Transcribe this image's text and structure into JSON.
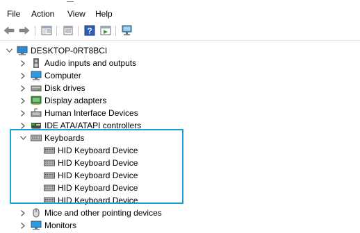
{
  "menu": {
    "file": "File",
    "action": "Action",
    "view": "View",
    "help": "Help"
  },
  "toolbar": {
    "icons": [
      "back-arrow-icon",
      "forward-arrow-icon",
      "show-hide-tree-icon",
      "properties-icon",
      "help-icon",
      "run-icon",
      "scan-hardware-icon"
    ]
  },
  "tree": {
    "root": "DESKTOP-0RT8BCI",
    "categories": [
      {
        "label": "Audio inputs and outputs",
        "icon": "speaker-icon"
      },
      {
        "label": "Computer",
        "icon": "monitor-icon"
      },
      {
        "label": "Disk drives",
        "icon": "disk-drive-icon"
      },
      {
        "label": "Display adapters",
        "icon": "display-adapter-icon"
      },
      {
        "label": "Human Interface Devices",
        "icon": "hid-icon"
      },
      {
        "label": "IDE ATA/ATAPI controllers",
        "icon": "ide-controller-icon"
      },
      {
        "label": "Keyboards",
        "icon": "keyboard-icon"
      },
      {
        "label": "Mice and other pointing devices",
        "icon": "mouse-icon"
      },
      {
        "label": "Monitors",
        "icon": "monitor-icon"
      }
    ],
    "keyboards": [
      "HID Keyboard Device",
      "HID Keyboard Device",
      "HID Keyboard Device",
      "HID Keyboard Device",
      "HID Keyboard Device"
    ]
  },
  "colors": {
    "highlight": "#1ba1d9"
  }
}
